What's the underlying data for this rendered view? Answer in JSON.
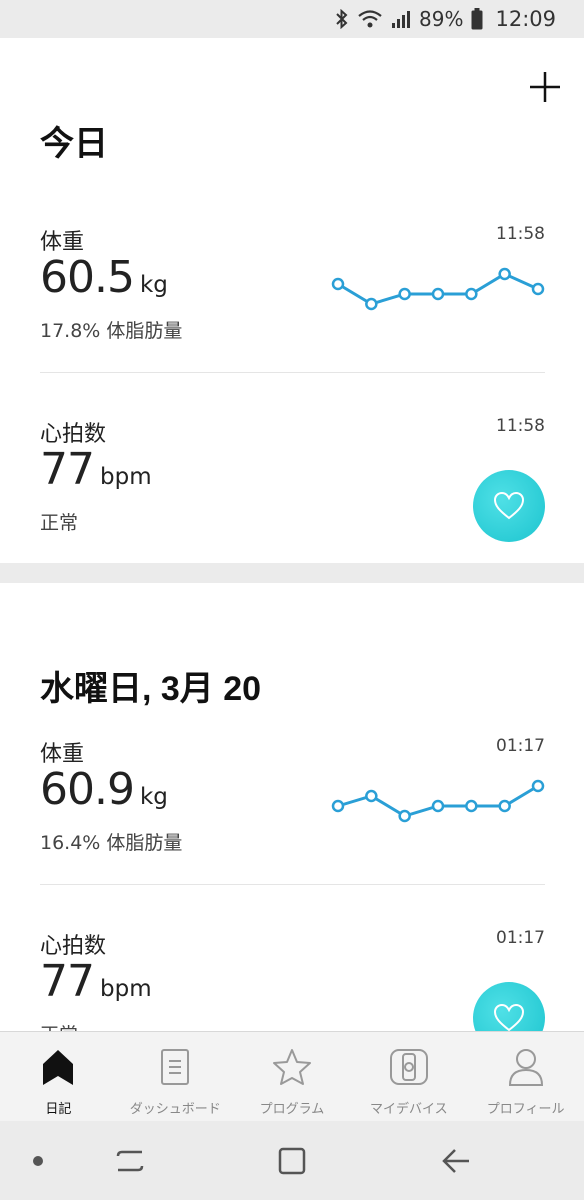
{
  "status_bar": {
    "battery_percent": "89%",
    "time": "12:09",
    "icons": [
      "bluetooth-icon",
      "wifi-icon",
      "signal-icon",
      "battery-icon"
    ]
  },
  "header": {
    "add_icon": "plus-icon"
  },
  "days": [
    {
      "title": "今日",
      "entries": [
        {
          "label": "体重",
          "time": "11:58",
          "value": "60.5",
          "unit": "kg",
          "sub": "17.8% 体脂肪量",
          "trend": [
            60.6,
            60.2,
            60.4,
            60.4,
            60.4,
            60.8,
            60.5
          ]
        },
        {
          "label": "心拍数",
          "time": "11:58",
          "value": "77",
          "unit": "bpm",
          "sub": "正常",
          "icon": "heart-icon"
        }
      ]
    },
    {
      "title": "水曜日, 3月 20",
      "entries": [
        {
          "label": "体重",
          "time": "01:17",
          "value": "60.9",
          "unit": "kg",
          "sub": "16.4% 体脂肪量",
          "trend": [
            60.9,
            61.0,
            60.8,
            60.9,
            60.9,
            60.9,
            61.1
          ]
        },
        {
          "label": "心拍数",
          "time": "01:17",
          "value": "77",
          "unit": "bpm",
          "sub": "正常",
          "icon": "heart-icon"
        }
      ]
    }
  ],
  "bottom_nav": [
    {
      "label": "日記",
      "icon": "home-icon",
      "active": true
    },
    {
      "label": "ダッシュボード",
      "icon": "document-icon",
      "active": false
    },
    {
      "label": "プログラム",
      "icon": "star-icon",
      "active": false
    },
    {
      "label": "マイデバイス",
      "icon": "watch-icon",
      "active": false
    },
    {
      "label": "プロフィール",
      "icon": "person-icon",
      "active": false
    }
  ],
  "colors": {
    "accent": "#2a9fd6",
    "heart_button": "#1cc4cf",
    "background": "#ebebeb",
    "card": "#ffffff"
  }
}
